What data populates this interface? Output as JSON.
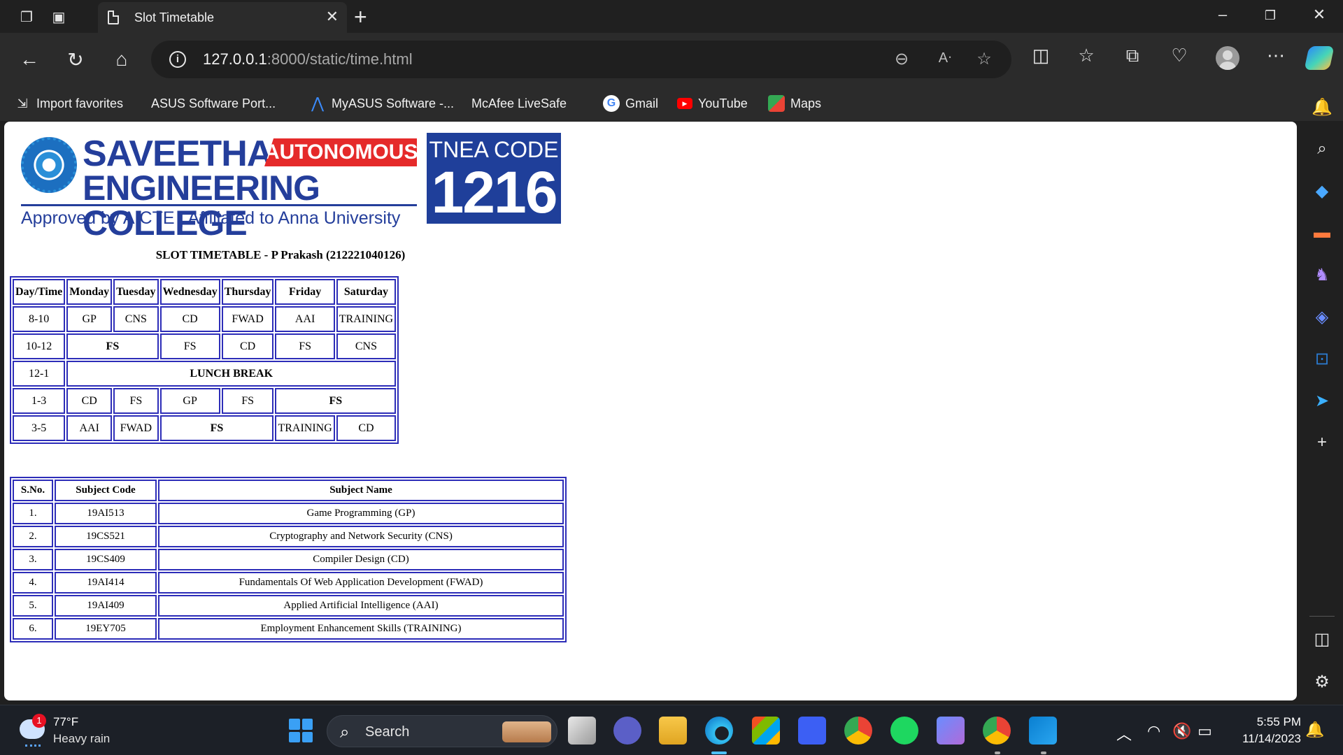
{
  "browser": {
    "tab_title": "Slot Timetable",
    "url_host": "127.0.0.1",
    "url_rest": ":8000/static/time.html"
  },
  "favorites": [
    {
      "label": "Import favorites",
      "icon": "import-icon"
    },
    {
      "label": "ASUS Software Port...",
      "icon": "page-icon"
    },
    {
      "label": "MyASUS Software -...",
      "icon": "myasus-icon"
    },
    {
      "label": "McAfee LiveSafe",
      "icon": "page-icon"
    },
    {
      "label": "Gmail",
      "icon": "google-icon"
    },
    {
      "label": "YouTube",
      "icon": "youtube-icon"
    },
    {
      "label": "Maps",
      "icon": "maps-icon"
    }
  ],
  "page": {
    "logo": {
      "name_line1": "SAVEETHA",
      "name_line2": "ENGINEERING COLLEGE",
      "badge": "AUTONOMOUS",
      "approved": "Approved by AICTE  |  Affiliated to Anna University",
      "tnea_label": "TNEA CODE",
      "tnea_code": "1216"
    },
    "title": "SLOT TIMETABLE - P Prakash (212221040126)",
    "slot_table": {
      "headers": [
        "Day/Time",
        "Monday",
        "Tuesday",
        "Wednesday",
        "Thursday",
        "Friday",
        "Saturday"
      ],
      "rows": [
        [
          "8-10",
          "GP",
          "CNS",
          "CD",
          "FWAD",
          "AAI",
          "TRAINING"
        ],
        [
          "10-12",
          "FS",
          "FS",
          "CD",
          "FS",
          "CNS"
        ],
        [
          "12-1",
          "LUNCH BREAK"
        ],
        [
          "1-3",
          "CD",
          "FS",
          "GP",
          "FS",
          "FS"
        ],
        [
          "3-5",
          "AAI",
          "FWAD",
          "FS",
          "TRAINING",
          "CD"
        ]
      ]
    },
    "subject_table": {
      "headers": [
        "S.No.",
        "Subject Code",
        "Subject Name"
      ],
      "rows": [
        [
          "1.",
          "19AI513",
          "Game Programming (GP)"
        ],
        [
          "2.",
          "19CS521",
          "Cryptography and Network Security (CNS)"
        ],
        [
          "3.",
          "19CS409",
          "Compiler Design (CD)"
        ],
        [
          "4.",
          "19AI414",
          "Fundamentals Of Web Application Development (FWAD)"
        ],
        [
          "5.",
          "19AI409",
          "Applied Artificial Intelligence (AAI)"
        ],
        [
          "6.",
          "19EY705",
          "Employment Enhancement Skills (TRAINING)"
        ]
      ]
    }
  },
  "taskbar": {
    "weather_temp": "77°F",
    "weather_desc": "Heavy rain",
    "weather_badge": "1",
    "search_label": "Search",
    "time": "5:55 PM",
    "date": "11/14/2023",
    "pinned": [
      "task-view",
      "meet",
      "file-explorer",
      "edge",
      "store",
      "code-app",
      "chrome",
      "spotify",
      "copilot-app",
      "chrome-profile",
      "vscode"
    ]
  }
}
